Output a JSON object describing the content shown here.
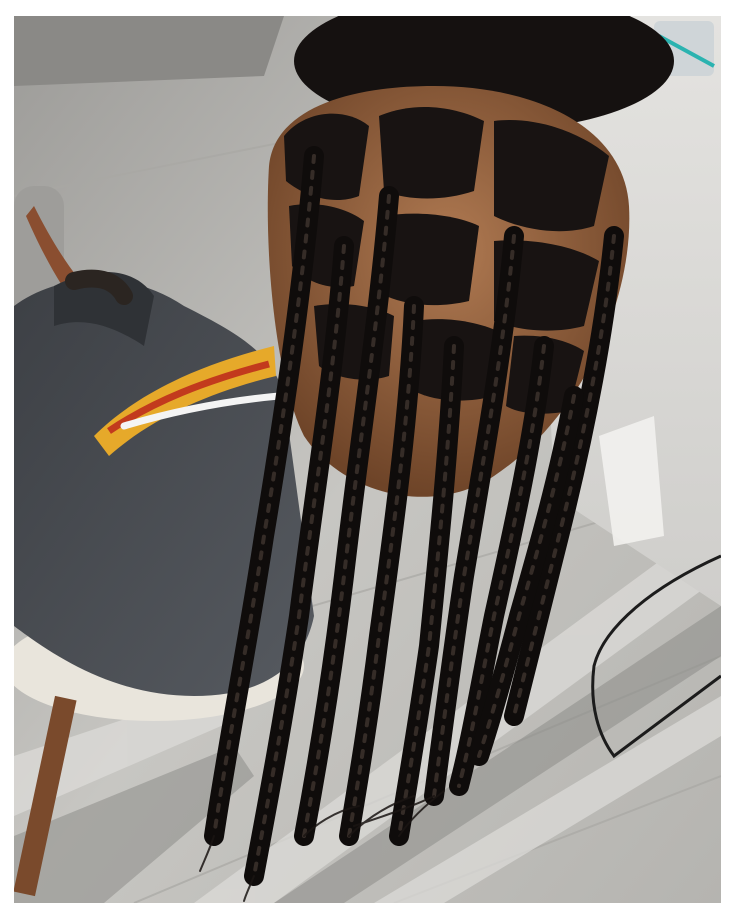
{
  "image": {
    "subject": "photo",
    "colors": {
      "frame": "#ffffff",
      "floor_light": "#c9c8c5",
      "floor_shadow": "#8e8d8b",
      "wall": "#d7d6d3",
      "hoodie": "#4a4d52",
      "hair": "#141110",
      "scalp": "#8a5a3b",
      "chair_wood": "#7a4a2c",
      "hoodie_print_yellow": "#e6a92a",
      "hoodie_print_red": "#c23a1d"
    }
  }
}
